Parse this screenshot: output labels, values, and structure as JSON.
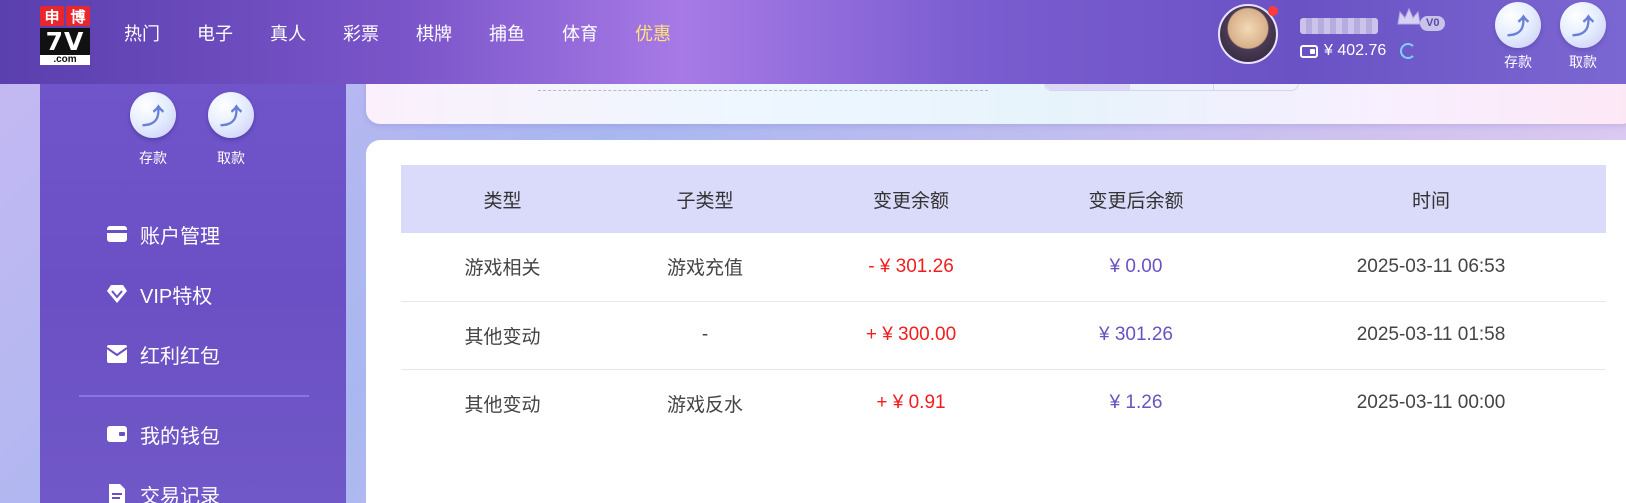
{
  "brand": {
    "chars": [
      "申",
      "博"
    ],
    "logo_main": "7V",
    "logo_sub": ".com"
  },
  "nav": [
    "热门",
    "电子",
    "真人",
    "彩票",
    "棋牌",
    "捕鱼",
    "体育",
    "优惠"
  ],
  "user": {
    "vip_level": "V0",
    "balance": "¥ 402.76"
  },
  "header_actions": {
    "deposit": "存款",
    "withdraw": "取款"
  },
  "sidebar": {
    "actions": {
      "deposit": "存款",
      "withdraw": "取款"
    },
    "menu": [
      {
        "label": "账户管理",
        "icon": "card-icon"
      },
      {
        "label": "VIP特权",
        "icon": "diamond-icon"
      },
      {
        "label": "红利红包",
        "icon": "envelope-icon"
      }
    ],
    "menu2": [
      {
        "label": "我的钱包",
        "icon": "wallet-icon"
      },
      {
        "label": "交易记录",
        "icon": "document-icon"
      }
    ]
  },
  "table": {
    "headers": [
      "类型",
      "子类型",
      "变更余额",
      "变更后余额",
      "时间"
    ],
    "rows": [
      {
        "type": "游戏相关",
        "subtype": "游戏充值",
        "change": "- ¥ 301.26",
        "after": "¥ 0.00",
        "time": "2025-03-11 06:53"
      },
      {
        "type": "其他变动",
        "subtype": "-",
        "change": "+ ¥ 300.00",
        "after": "¥ 301.26",
        "time": "2025-03-11 01:58"
      },
      {
        "type": "其他变动",
        "subtype": "游戏反水",
        "change": "+ ¥ 0.91",
        "after": "¥ 1.26",
        "time": "2025-03-11 00:00"
      }
    ]
  },
  "colors": {
    "accent": "#6a52c4",
    "negative": "#f01e1e",
    "promo": "#ffe27a"
  }
}
